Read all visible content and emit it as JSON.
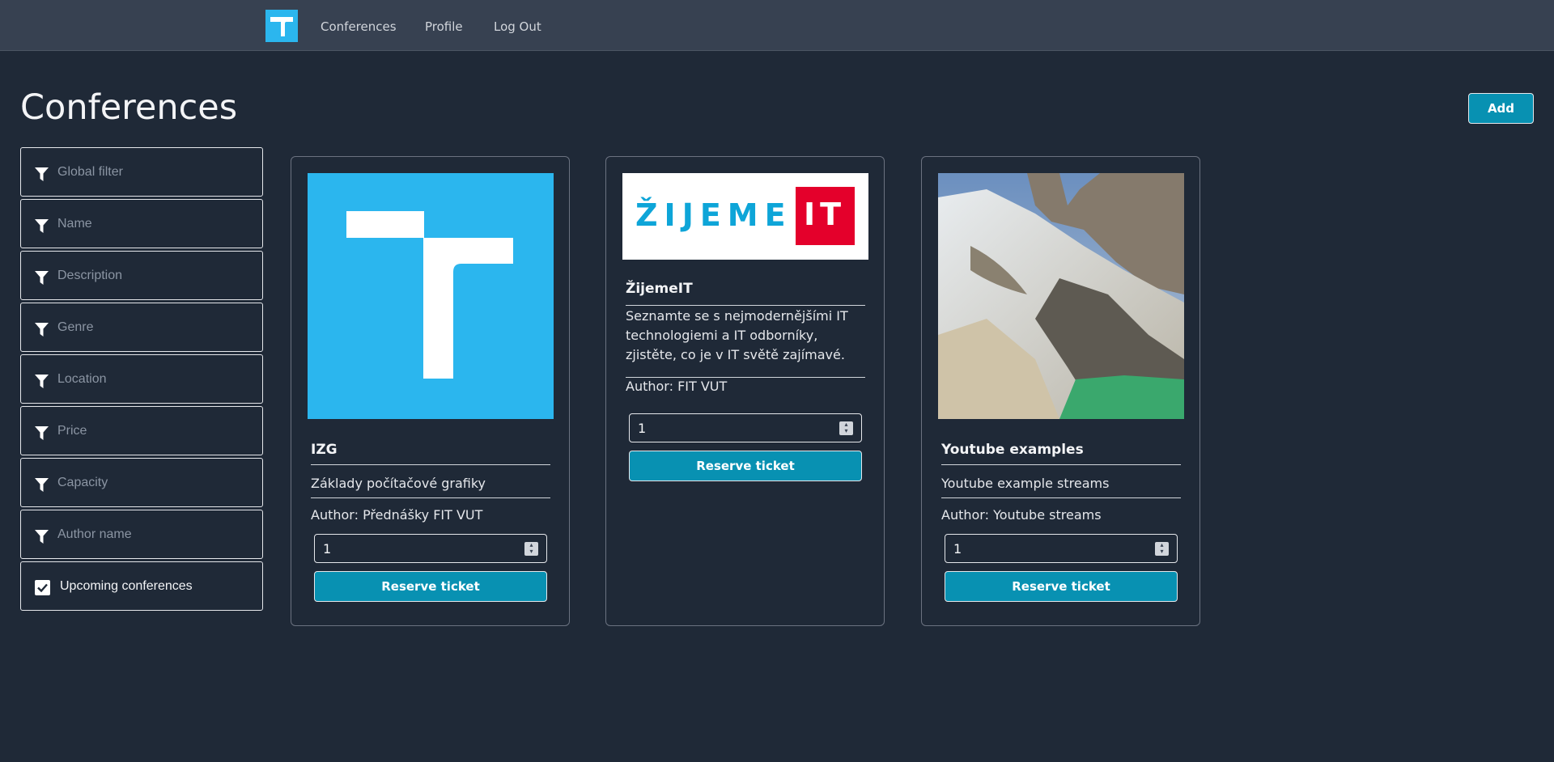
{
  "nav": {
    "logo_icon": "t-logo-icon",
    "links": [
      "Conferences",
      "Profile",
      "Log Out"
    ]
  },
  "page": {
    "title": "Conferences",
    "add_label": "Add"
  },
  "filters": {
    "placeholders": [
      "Global filter",
      "Name",
      "Description",
      "Genre",
      "Location",
      "Price",
      "Capacity",
      "Author name"
    ],
    "filter_icon": "filter-icon",
    "upcoming_label": "Upcoming conferences",
    "upcoming_checked": true
  },
  "conferences": [
    {
      "name": "IZG",
      "description": "Základy počítačové grafiky",
      "author": "Author: Přednášky FIT VUT",
      "quantity": "1",
      "reserve_label": "Reserve ticket",
      "image": "t-logo-image"
    },
    {
      "name": "ŽijemeIT",
      "description": "Seznamte se s nejmodernějšími IT technologiemi a IT odborníky, zjistěte, co je v IT světě zajímavé.",
      "author": "Author: FIT VUT",
      "quantity": "1",
      "reserve_label": "Reserve ticket",
      "image": "zijemeit-logo-image",
      "logo_text": "ŽIJEME",
      "logo_badge": "IT"
    },
    {
      "name": "Youtube examples",
      "description": "Youtube example streams",
      "author": "Author: Youtube streams",
      "quantity": "1",
      "reserve_label": "Reserve ticket",
      "image": "mountain-landscape-image"
    }
  ],
  "colors": {
    "background": "#1f2937",
    "navbar": "#374151",
    "accent": "#0891b2",
    "logo_blue": "#2bb6ee",
    "zijeme_red": "#e4002b"
  }
}
